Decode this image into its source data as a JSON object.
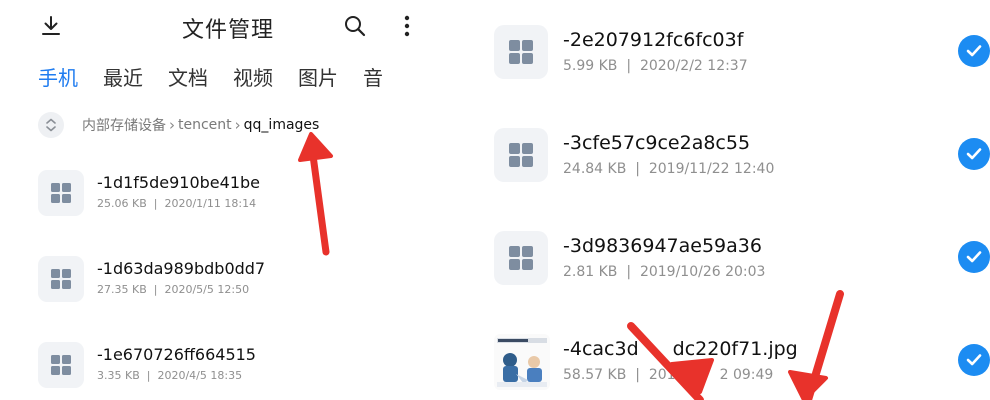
{
  "header": {
    "title": "文件管理",
    "download_icon": "download-icon",
    "search_icon": "search-icon",
    "more_icon": "more-vertical-icon"
  },
  "tabs": [
    {
      "label": "手机",
      "active": true
    },
    {
      "label": "最近"
    },
    {
      "label": "文档"
    },
    {
      "label": "视频"
    },
    {
      "label": "图片"
    },
    {
      "label": "音"
    }
  ],
  "breadcrumb": {
    "path": [
      "内部存储设备",
      "tencent",
      "qq_images"
    ],
    "separator": "›"
  },
  "left_files": [
    {
      "name": "-1d1f5de910be41be",
      "size": "25.06 KB",
      "date": "2020/1/11 18:14"
    },
    {
      "name": "-1d63da989bdb0dd7",
      "size": "27.35 KB",
      "date": "2020/5/5 12:50"
    },
    {
      "name": "-1e670726ff664515",
      "size": "3.35 KB",
      "date": "2020/4/5 18:35"
    }
  ],
  "right_files": [
    {
      "name": "-2e207912fc6fc03f",
      "size": "5.99 KB",
      "date": "2020/2/2 12:37",
      "selected": true
    },
    {
      "name": "-3cfe57c9ce2a8c55",
      "size": "24.84 KB",
      "date": "2019/11/22 12:40",
      "selected": true
    },
    {
      "name": "-3d9836947ae59a36",
      "size": "2.81 KB",
      "date": "2019/10/26 20:03",
      "selected": true
    },
    {
      "name": "-4cac3d",
      "name_tail": "dc220f71.jpg",
      "size": "58.57 KB",
      "date_head": "201",
      "date_tail": "2 09:49",
      "selected": true
    }
  ],
  "meta_separator": "|",
  "colors": {
    "accent": "#1f7cf0",
    "check": "#1c8cf2",
    "annotation_arrow": "#e8322b",
    "icon_bg": "#f1f3f6",
    "icon_tile": "#7e8da0"
  }
}
